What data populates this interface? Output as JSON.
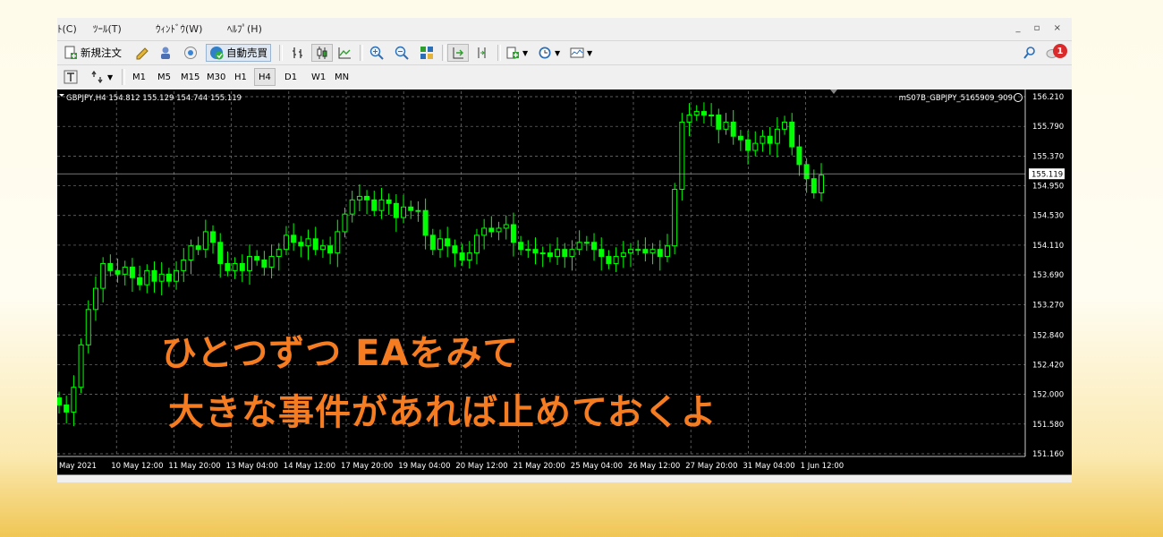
{
  "menu": [
    "ﾄ(C)",
    "ﾂｰﾙ(T)",
    "ｳｨﾝﾄﾞｳ(W)",
    "ﾍﾙﾌﾟ(H)"
  ],
  "window_controls": "_ ▫ ×",
  "toolbar1": {
    "new_order_label": "新規注文",
    "auto_trade_label": "自動売買"
  },
  "timeframes": [
    "M1",
    "M5",
    "M15",
    "M30",
    "H1",
    "H4",
    "D1",
    "W1",
    "MN"
  ],
  "selected_timeframe": "H4",
  "notification_count": "1",
  "chart": {
    "header_text": "GBPJPY,H4  154.812 155.129 154.744 155.119",
    "ea_label": "mS07B_GBPJPY_5165909_909",
    "current_price": "155.119"
  },
  "chart_data": {
    "type": "candlestick",
    "symbol": "GBPJPY",
    "timeframe": "H4",
    "colors": {
      "background": "#000000",
      "candle": "#00ff00",
      "grid": "#808080",
      "price_box": "#ffffff"
    },
    "grid": true,
    "ylim": [
      151.16,
      156.21
    ],
    "y_ticks": [
      "156.210",
      "155.790",
      "155.370",
      "154.950",
      "154.530",
      "154.110",
      "153.690",
      "153.270",
      "152.840",
      "152.420",
      "152.000",
      "151.580",
      "151.160"
    ],
    "x_ticks": [
      "May 2021",
      "10 May 12:00",
      "11 May 20:00",
      "13 May 04:00",
      "14 May 12:00",
      "17 May 20:00",
      "19 May 04:00",
      "20 May 12:00",
      "21 May 20:00",
      "25 May 04:00",
      "26 May 12:00",
      "27 May 20:00",
      "31 May 04:00",
      "1 Jun 12:00"
    ],
    "closes": [
      151.85,
      151.75,
      152.1,
      152.7,
      153.2,
      153.5,
      153.85,
      153.75,
      153.7,
      153.8,
      153.65,
      153.55,
      153.75,
      153.6,
      153.7,
      153.6,
      153.75,
      153.9,
      154.1,
      154.05,
      154.3,
      154.15,
      153.85,
      153.75,
      153.85,
      153.75,
      153.95,
      153.9,
      153.8,
      153.95,
      154.05,
      154.25,
      154.15,
      154.1,
      154.2,
      154.05,
      154.1,
      154.0,
      154.3,
      154.55,
      154.75,
      154.8,
      154.75,
      154.6,
      154.75,
      154.7,
      154.5,
      154.65,
      154.6,
      154.6,
      154.25,
      154.05,
      154.2,
      154.1,
      154.0,
      153.9,
      154.0,
      154.25,
      154.35,
      154.3,
      154.35,
      154.4,
      154.15,
      154.05,
      154.05,
      154.0,
      154.0,
      153.95,
      154.05,
      153.95,
      154.05,
      154.15,
      154.15,
      154.05,
      153.95,
      153.85,
      153.95,
      154.0,
      154.05,
      154.05,
      154.0,
      154.05,
      153.95,
      154.1,
      154.9,
      155.85,
      155.95,
      156.0,
      155.95,
      155.95,
      155.75,
      155.85,
      155.65,
      155.6,
      155.45,
      155.55,
      155.65,
      155.55,
      155.75,
      155.85,
      155.5,
      155.25,
      155.05,
      154.85,
      155.1
    ],
    "annotations": [
      "ひとつずつ EAをみて",
      "大きな事件があれば止めておくよ"
    ]
  }
}
